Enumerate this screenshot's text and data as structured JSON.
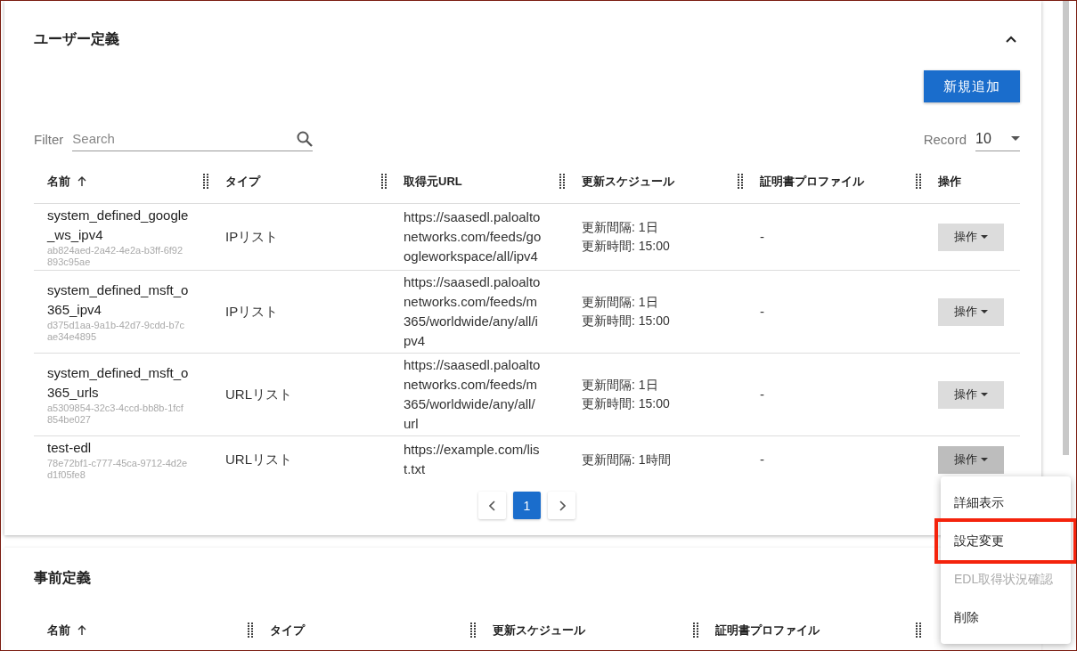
{
  "user_section": {
    "title": "ユーザー定義",
    "expanded": true,
    "add_button": "新規追加",
    "filter": {
      "label": "Filter",
      "placeholder": "Search"
    },
    "record": {
      "label": "Record",
      "value": "10"
    },
    "columns": [
      {
        "label": "名前",
        "sorted": true
      },
      {
        "label": "タイプ"
      },
      {
        "label": "取得元URL"
      },
      {
        "label": "更新スケジュール"
      },
      {
        "label": "証明書プロファイル"
      },
      {
        "label": "操作"
      }
    ],
    "rows": [
      {
        "name": "system_defined_google_ws_ipv4",
        "id": "ab824aed-2a42-4e2a-b3ff-6f92893c95ae",
        "type": "IPリスト",
        "url": "https://saasedl.paloaltonetworks.com/feeds/googleworkspace/all/ipv4",
        "schedule": [
          "更新間隔: 1日",
          "更新時間: 15:00"
        ],
        "certificate": "-",
        "action": "操作",
        "pressed": false
      },
      {
        "name": "system_defined_msft_o365_ipv4",
        "id": "d375d1aa-9a1b-42d7-9cdd-b7cae34e4895",
        "type": "IPリスト",
        "url": "https://saasedl.paloaltonetworks.com/feeds/m365/worldwide/any/all/ipv4",
        "schedule": [
          "更新間隔: 1日",
          "更新時間: 15:00"
        ],
        "certificate": "-",
        "action": "操作",
        "pressed": false
      },
      {
        "name": "system_defined_msft_o365_urls",
        "id": "a5309854-32c3-4ccd-bb8b-1fcf854be027",
        "type": "URLリスト",
        "url": "https://saasedl.paloaltonetworks.com/feeds/m365/worldwide/any/all/url",
        "schedule": [
          "更新間隔: 1日",
          "更新時間: 15:00"
        ],
        "certificate": "-",
        "action": "操作",
        "pressed": false
      },
      {
        "name": "test-edl",
        "id": "78e72bf1-c777-45ca-9712-4d2ed1f05fe8",
        "type": "URLリスト",
        "url": "https://example.com/list.txt",
        "schedule": [
          "更新間隔: 1時間"
        ],
        "certificate": "-",
        "action": "操作",
        "pressed": true
      }
    ],
    "pagination": [
      {
        "label": "1",
        "selected": true
      }
    ]
  },
  "predefined_section": {
    "title": "事前定義",
    "columns": [
      {
        "label": "名前",
        "sorted": true
      },
      {
        "label": "タイプ"
      },
      {
        "label": "更新スケジュール"
      },
      {
        "label": "証明書プロファイル"
      }
    ]
  },
  "action_menu": [
    {
      "label": "詳細表示",
      "disabled": false,
      "highlighted": false
    },
    {
      "label": "設定変更",
      "disabled": false,
      "highlighted": true
    },
    {
      "label": "EDL取得状況確認",
      "disabled": true,
      "highlighted": false
    },
    {
      "label": "削除",
      "disabled": false,
      "highlighted": false
    }
  ]
}
